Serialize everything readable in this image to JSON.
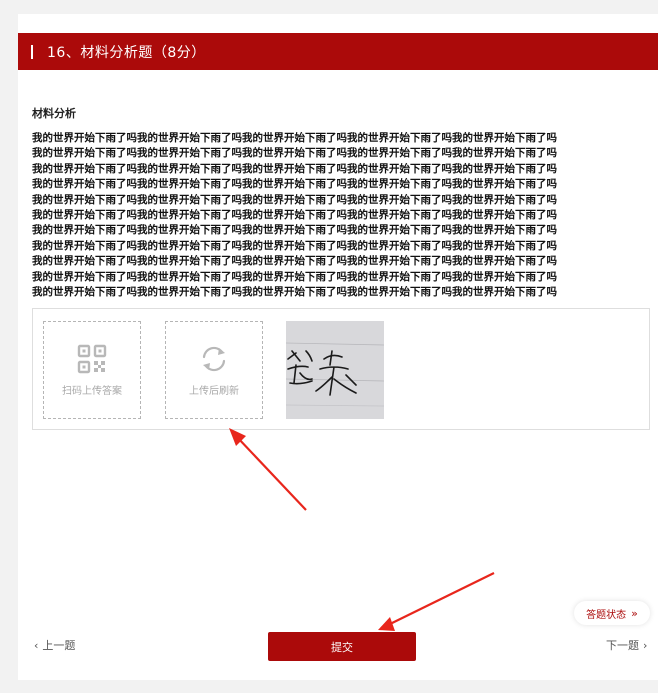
{
  "question": {
    "title": "16、材料分析题（8分）"
  },
  "material": {
    "label": "材料分析",
    "lines": [
      "我的世界开始下雨了吗我的世界开始下雨了吗我的世界开始下雨了吗我的世界开始下雨了吗我的世界开始下雨了吗",
      "我的世界开始下雨了吗我的世界开始下雨了吗我的世界开始下雨了吗我的世界开始下雨了吗我的世界开始下雨了吗",
      "我的世界开始下雨了吗我的世界开始下雨了吗我的世界开始下雨了吗我的世界开始下雨了吗我的世界开始下雨了吗",
      "我的世界开始下雨了吗我的世界开始下雨了吗我的世界开始下雨了吗我的世界开始下雨了吗我的世界开始下雨了吗",
      "我的世界开始下雨了吗我的世界开始下雨了吗我的世界开始下雨了吗我的世界开始下雨了吗我的世界开始下雨了吗",
      "我的世界开始下雨了吗我的世界开始下雨了吗我的世界开始下雨了吗我的世界开始下雨了吗我的世界开始下雨了吗",
      "我的世界开始下雨了吗我的世界开始下雨了吗我的世界开始下雨了吗我的世界开始下雨了吗我的世界开始下雨了吗",
      "我的世界开始下雨了吗我的世界开始下雨了吗我的世界开始下雨了吗我的世界开始下雨了吗我的世界开始下雨了吗",
      "我的世界开始下雨了吗我的世界开始下雨了吗我的世界开始下雨了吗我的世界开始下雨了吗我的世界开始下雨了吗",
      "我的世界开始下雨了吗我的世界开始下雨了吗我的世界开始下雨了吗我的世界开始下雨了吗我的世界开始下雨了吗",
      "我的世界开始下雨了吗我的世界开始下雨了吗我的世界开始下雨了吗我的世界开始下雨了吗我的世界开始下雨了吗"
    ]
  },
  "upload": {
    "scan_label": "扫码上传答案",
    "scan_icon": "qr-code-icon",
    "refresh_label": "上传后刷新",
    "refresh_icon": "refresh-icon",
    "thumbnail_text": "答案"
  },
  "nav": {
    "status_label": "答题状态",
    "status_icon": "double-chevron-right-icon",
    "prev_label": "上一题",
    "next_label": "下一题",
    "submit_label": "提交"
  },
  "colors": {
    "accent": "#ab0a0a",
    "background": "#f2f2f2",
    "muted_icon": "#b8b8b8",
    "annotation_arrow": "#e8261c"
  }
}
